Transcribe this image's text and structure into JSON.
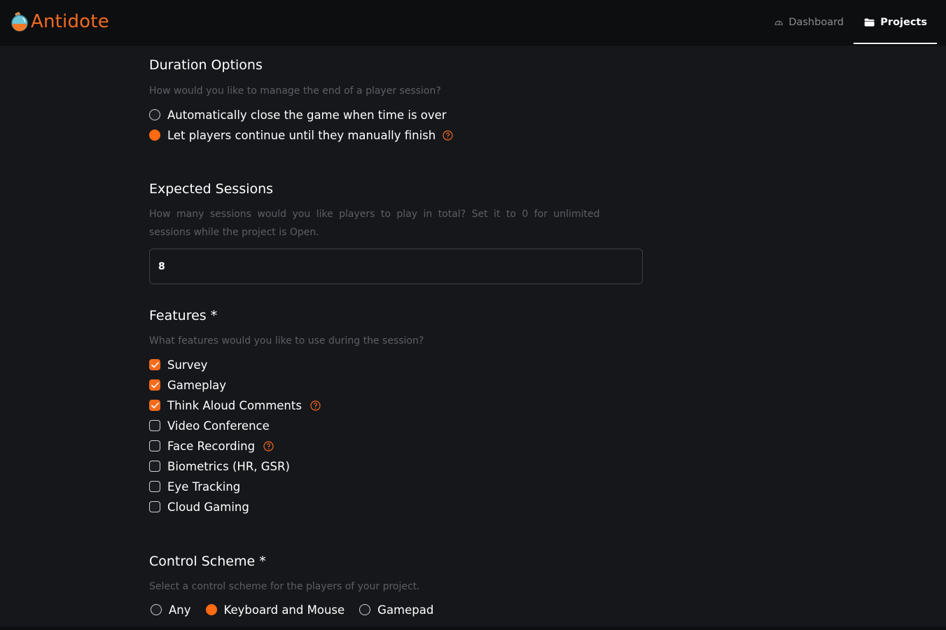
{
  "header": {
    "brand": "Antidote",
    "nav": [
      {
        "label": "Dashboard",
        "icon": "dashboard-gauge-icon",
        "active": false
      },
      {
        "label": "Projects",
        "icon": "folder-icon",
        "active": true
      }
    ]
  },
  "colors": {
    "accent": "#ff6a13",
    "background": "#16171b",
    "topbar": "#0d0e10",
    "muted_text": "#5d5f65"
  },
  "duration": {
    "title": "Duration Options",
    "description": "How would you like to manage the end of a player session?",
    "options": [
      {
        "label": "Automatically close the game when time is over",
        "selected": false,
        "help": false
      },
      {
        "label": "Let players continue until they manually finish",
        "selected": true,
        "help": true
      }
    ]
  },
  "sessions": {
    "title": "Expected Sessions",
    "description_line1": "How many sessions would you like players to play in total? Set it to 0 for unlimited",
    "description_line2": "sessions while the project is Open.",
    "value": "8"
  },
  "features": {
    "title": "Features *",
    "description": "What features would you like to use during the session?",
    "items": [
      {
        "label": "Survey",
        "checked": true,
        "help": false
      },
      {
        "label": "Gameplay",
        "checked": true,
        "help": false
      },
      {
        "label": "Think Aloud Comments",
        "checked": true,
        "help": true
      },
      {
        "label": "Video Conference",
        "checked": false,
        "help": false
      },
      {
        "label": "Face Recording",
        "checked": false,
        "help": true
      },
      {
        "label": "Biometrics (HR, GSR)",
        "checked": false,
        "help": false
      },
      {
        "label": "Eye Tracking",
        "checked": false,
        "help": false
      },
      {
        "label": "Cloud Gaming",
        "checked": false,
        "help": false
      }
    ]
  },
  "control": {
    "title": "Control Scheme *",
    "description": "Select a control scheme for the players of your project.",
    "options": [
      {
        "label": "Any",
        "selected": false
      },
      {
        "label": "Keyboard and Mouse",
        "selected": true
      },
      {
        "label": "Gamepad",
        "selected": false
      }
    ]
  }
}
